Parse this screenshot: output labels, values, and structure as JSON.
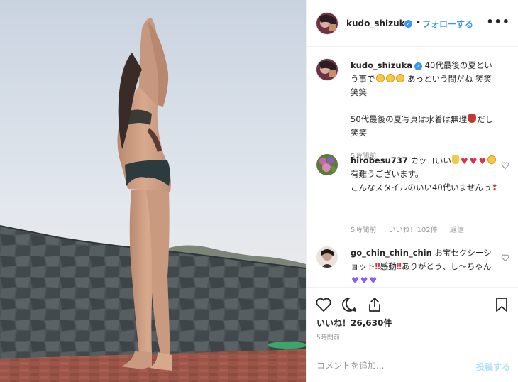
{
  "colors": {
    "link": "#3897f0",
    "text": "#262626",
    "muted": "#999999",
    "post_disabled": "#b2dffc"
  },
  "header": {
    "username": "kudo_shizuka",
    "separator": "•",
    "follow_label": "フォローする",
    "more_label": "•••",
    "verified_icon": "verified-badge-icon"
  },
  "caption": {
    "username": "kudo_shizuka",
    "text_1": "40代最後の夏という事で",
    "text_2": "あっという間だね 笑笑笑笑",
    "text_3": "50代最後の夏写真は水着は無理",
    "text_4": "だし 笑笑",
    "time": "5時間前"
  },
  "comments": [
    {
      "username": "hirobesu737",
      "text_1": "カッコいい",
      "text_2": "有難うございます。",
      "text_3": "こんなスタイルのいい40代いませんっ",
      "time": "5時間前",
      "likes": "いいね！102件",
      "reply": "返信"
    },
    {
      "username": "go_chin_chin_chin",
      "text_1": "お宝セクシーショット",
      "text_2": "感動",
      "text_3": "ありがとう、し〜ちゃん"
    }
  ],
  "actions": {
    "like_icon": "heart-icon",
    "comment_icon": "comment-icon",
    "share_icon": "share-icon",
    "save_icon": "bookmark-icon"
  },
  "likes_text": "いいね！26,630件",
  "time_ago": "5時間前",
  "add_comment": {
    "placeholder": "コメントを追加...",
    "post_label": "投稿する"
  }
}
